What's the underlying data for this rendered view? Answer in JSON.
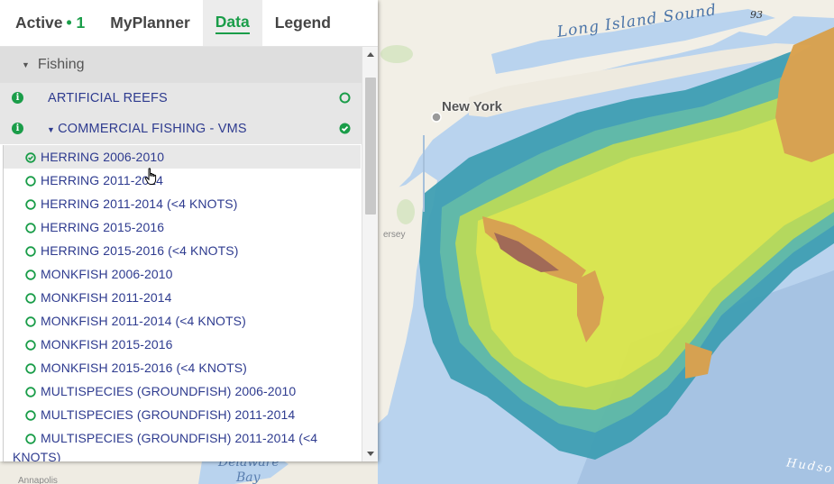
{
  "tabs": [
    {
      "label": "Active",
      "count": "• 1"
    },
    {
      "label": "MyPlanner"
    },
    {
      "label": "Data"
    },
    {
      "label": "Legend"
    }
  ],
  "active_tab": "Data",
  "category": {
    "label": "Fishing",
    "expanded": true
  },
  "layers": [
    {
      "label": "ARTIFICIAL REEFS",
      "state": "off"
    },
    {
      "label": "COMMERCIAL FISHING - VMS",
      "state": "on",
      "expanded": true
    }
  ],
  "sublayers": [
    {
      "label": "HERRING 2006-2010",
      "state": "on"
    },
    {
      "label": "HERRING 2011-2014",
      "state": "off"
    },
    {
      "label": "HERRING 2011-2014 (<4 KNOTS)",
      "state": "off"
    },
    {
      "label": "HERRING 2015-2016",
      "state": "off"
    },
    {
      "label": "HERRING 2015-2016 (<4 KNOTS)",
      "state": "off"
    },
    {
      "label": "MONKFISH 2006-2010",
      "state": "off"
    },
    {
      "label": "MONKFISH 2011-2014",
      "state": "off"
    },
    {
      "label": "MONKFISH 2011-2014 (<4 KNOTS)",
      "state": "off"
    },
    {
      "label": "MONKFISH 2015-2016",
      "state": "off"
    },
    {
      "label": "MONKFISH 2015-2016 (<4 KNOTS)",
      "state": "off"
    },
    {
      "label": "MULTISPECIES (GROUNDFISH) 2006-2010",
      "state": "off"
    },
    {
      "label": "MULTISPECIES (GROUNDFISH) 2011-2014",
      "state": "off"
    },
    {
      "label": "MULTISPECIES (GROUNDFISH) 2011-2014 (<4",
      "state": "off"
    },
    {
      "label": "KNOTS)",
      "state": "continuation"
    }
  ],
  "map_labels": {
    "sound": "Long Island Sound",
    "city": "New York",
    "route": "93",
    "state_fragment": "ersey",
    "bay_line1": "Delaware",
    "bay_line2": "Bay",
    "canyon_fragment": "Hudso",
    "town_fragment": "Annapolis"
  },
  "colors": {
    "accent_green": "#1a9d49",
    "layer_text": "#2e3b8f",
    "ocean": "#b9d3ee",
    "land": "#f2efe6",
    "heat_low": "#3f9fb4",
    "heat_mid": "#d9e64c",
    "heat_high": "#d9a04a",
    "heat_peak": "#a0654f"
  },
  "icons": {
    "info": "info-icon",
    "toggle_on": "check-circle-icon",
    "toggle_off": "empty-circle-icon",
    "caret_down": "caret-down-icon",
    "cursor": "hand-pointer-icon"
  }
}
